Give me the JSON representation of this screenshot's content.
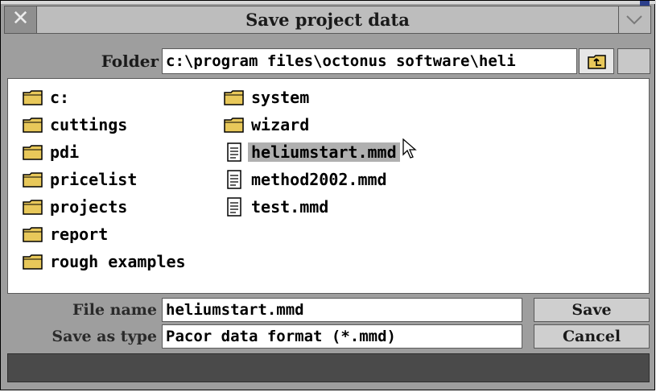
{
  "dialog": {
    "title": "Save project data",
    "close_icon": "close-icon",
    "menu_icon": "chevron-down-icon"
  },
  "folder": {
    "label": "Folder",
    "path": "c:\\program files\\octonus software\\heli",
    "up_icon": "folder-up-icon"
  },
  "files": {
    "column1": [
      {
        "name": "c:",
        "type": "folder"
      },
      {
        "name": "cuttings",
        "type": "folder"
      },
      {
        "name": "pdi",
        "type": "folder"
      },
      {
        "name": "pricelist",
        "type": "folder"
      },
      {
        "name": "projects",
        "type": "folder"
      },
      {
        "name": "report",
        "type": "folder"
      },
      {
        "name": "rough examples",
        "type": "folder"
      }
    ],
    "column2": [
      {
        "name": "system",
        "type": "folder"
      },
      {
        "name": "wizard",
        "type": "folder"
      },
      {
        "name": "heliumstart.mmd",
        "type": "file",
        "selected": true
      },
      {
        "name": "method2002.mmd",
        "type": "file"
      },
      {
        "name": "test.mmd",
        "type": "file"
      }
    ]
  },
  "filename": {
    "label": "File name",
    "value": "heliumstart.mmd"
  },
  "filetype": {
    "label": "Save as type",
    "value": "Pacor data format (*.mmd)"
  },
  "buttons": {
    "save": "Save",
    "cancel": "Cancel"
  },
  "colors": {
    "dialog_bg": "#9e9e9e",
    "folder_icon": "#e8c85a",
    "selection": "#b0b0b0"
  }
}
